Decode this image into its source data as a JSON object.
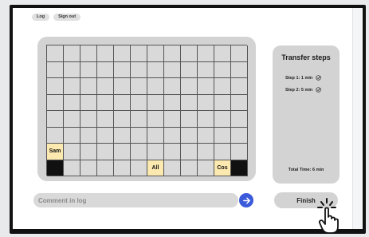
{
  "top_buttons": [
    {
      "label": "Log"
    },
    {
      "label": "Sign out"
    }
  ],
  "board": {
    "rows": 8,
    "cols": 12,
    "labeled_cells": [
      {
        "row": 6,
        "col": 0,
        "text": "Sam",
        "style": "label"
      },
      {
        "row": 7,
        "col": 0,
        "text": "",
        "style": "dark"
      },
      {
        "row": 7,
        "col": 6,
        "text": "All",
        "style": "label"
      },
      {
        "row": 7,
        "col": 10,
        "text": "Cos",
        "style": "label"
      },
      {
        "row": 7,
        "col": 11,
        "text": "",
        "style": "dark"
      }
    ]
  },
  "steps_panel": {
    "title": "Transfer steps",
    "steps": [
      {
        "label": "Step 1: 1 min",
        "icon": "check-circle-icon"
      },
      {
        "label": "Step 2: 5 min",
        "icon": "check-circle-icon"
      }
    ],
    "total": "Total Time: 6 min"
  },
  "comment": {
    "placeholder": "Comment in log",
    "value": ""
  },
  "send": {
    "icon": "arrow-right-icon",
    "color": "#3b5bdb"
  },
  "finish": {
    "label": "Finish"
  },
  "colors": {
    "label_cell": "#fce9b0",
    "dark_cell": "#111111",
    "panel": "#d3d3d3"
  }
}
